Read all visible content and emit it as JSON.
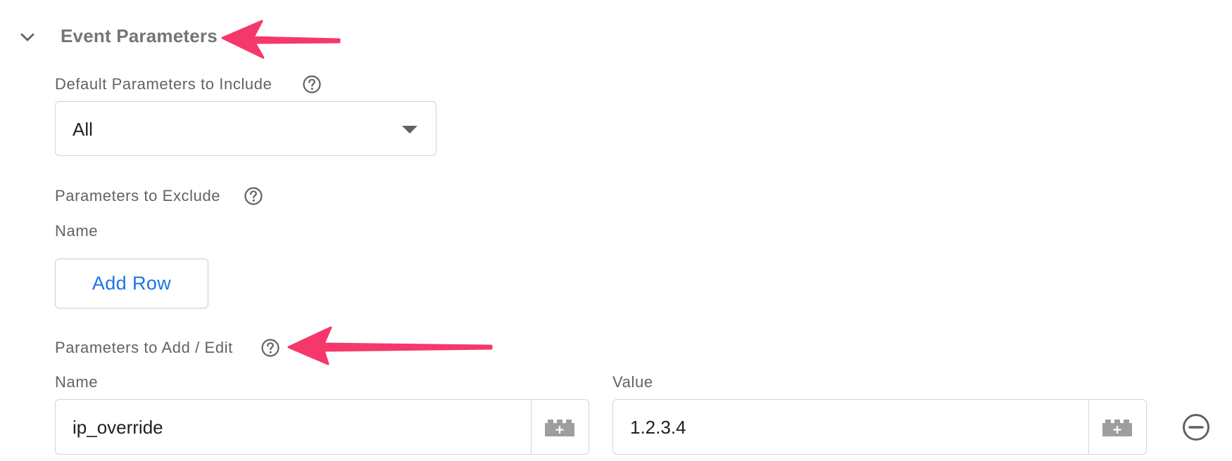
{
  "section": {
    "title": "Event Parameters",
    "expanded_icon": "chevron-down-icon"
  },
  "default_params": {
    "label": "Default Parameters to Include",
    "selected": "All"
  },
  "exclude": {
    "label": "Parameters to Exclude",
    "column_name": "Name",
    "add_row_label": "Add Row"
  },
  "add_edit": {
    "label": "Parameters to Add / Edit",
    "name_header": "Name",
    "value_header": "Value",
    "rows": [
      {
        "name": "ip_override",
        "value": "1.2.3.4"
      }
    ]
  },
  "icons": {
    "help": "help-circle-icon",
    "variable": "variable-brick-icon",
    "remove": "remove-circle-icon"
  },
  "colors": {
    "accent": "#1a73e8",
    "annotation_arrow": "#f5386b"
  }
}
